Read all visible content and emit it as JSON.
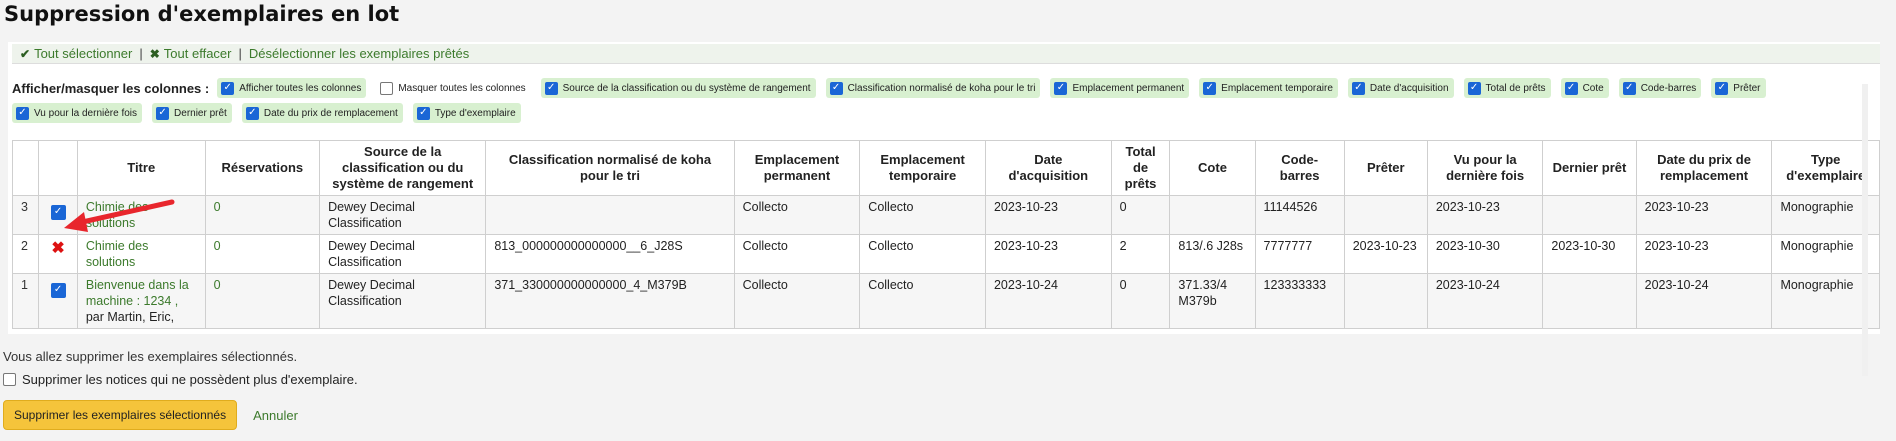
{
  "title": "Suppression d'exemplaires en lot",
  "toolbar": {
    "select_all": "Tout sélectionner",
    "clear_all": "Tout effacer",
    "deselect_loaned": "Désélectionner les exemplaires prêtés",
    "separator": "|"
  },
  "columns_toggle": {
    "label": "Afficher/masquer les colonnes :",
    "options": [
      {
        "label": "Afficher toutes les colonnes",
        "checked": true
      },
      {
        "label": "Masquer toutes les colonnes",
        "checked": false
      },
      {
        "label": "Source de la classification ou du système de rangement",
        "checked": true
      },
      {
        "label": "Classification normalisé de koha pour le tri",
        "checked": true
      },
      {
        "label": "Emplacement permanent",
        "checked": true
      },
      {
        "label": "Emplacement temporaire",
        "checked": true
      },
      {
        "label": "Date d'acquisition",
        "checked": true
      },
      {
        "label": "Total de prêts",
        "checked": true
      },
      {
        "label": "Cote",
        "checked": true
      },
      {
        "label": "Code-barres",
        "checked": true
      },
      {
        "label": "Prêter",
        "checked": true
      },
      {
        "label": "Vu pour la dernière fois",
        "checked": true
      },
      {
        "label": "Dernier prêt",
        "checked": true
      },
      {
        "label": "Date du prix de remplacement",
        "checked": true
      },
      {
        "label": "Type d'exemplaire",
        "checked": true
      }
    ]
  },
  "table": {
    "headers": [
      "Titre",
      "Réservations",
      "Source de la classification ou du système de rangement",
      "Classification normalisé de koha pour le tri",
      "Emplacement permanent",
      "Emplacement temporaire",
      "Date d'acquisition",
      "Total de prêts",
      "Cote",
      "Code-barres",
      "Prêter",
      "Vu pour la dernière fois",
      "Dernier prêt",
      "Date du prix de remplacement",
      "Type d'exemplaire"
    ],
    "rows": [
      {
        "num": "3",
        "state": "checked",
        "title": "Chimie des solutions",
        "author": "",
        "reservations": "0",
        "source": "Dewey Decimal Classification",
        "sort": "",
        "perm": "Collecto",
        "temp": "Collecto",
        "acq": "2023-10-23",
        "issues": "0",
        "cote": "",
        "barcode": "11144526",
        "loaned": "",
        "seen": "2023-10-23",
        "last_loan": "",
        "repl_date": "2023-10-23",
        "type": "Monographie"
      },
      {
        "num": "2",
        "state": "blocked",
        "title": "Chimie des solutions",
        "author": "",
        "reservations": "0",
        "source": "Dewey Decimal Classification",
        "sort": "813_000000000000000__6_J28S",
        "perm": "Collecto",
        "temp": "Collecto",
        "acq": "2023-10-23",
        "issues": "2",
        "cote": "813/.6 J28s",
        "barcode": "7777777",
        "loaned": "2023-10-23",
        "seen": "2023-10-30",
        "last_loan": "2023-10-30",
        "repl_date": "2023-10-23",
        "type": "Monographie"
      },
      {
        "num": "1",
        "state": "checked",
        "title": "Bienvenue dans la machine : 1234 ,",
        "author": "par Martin, Eric,",
        "reservations": "0",
        "source": "Dewey Decimal Classification",
        "sort": "371_330000000000000_4_M379B",
        "perm": "Collecto",
        "temp": "Collecto",
        "acq": "2023-10-24",
        "issues": "0",
        "cote": "371.33/4 M379b",
        "barcode": "123333333",
        "loaned": "",
        "seen": "2023-10-24",
        "last_loan": "",
        "repl_date": "2023-10-24",
        "type": "Monographie"
      }
    ]
  },
  "warning": "Vous allez supprimer les exemplaires sélectionnés.",
  "delete_records_label": "Supprimer les notices qui ne possèdent plus d'exemplaire.",
  "delete_button": "Supprimer les exemplaires sélectionnés",
  "cancel": "Annuler",
  "colors": {
    "accent_link": "#3c7a2c",
    "chip_bg": "#d8f0d0",
    "checkbox": "#1a66d6",
    "button": "#f5c43b",
    "annotation_arrow": "#e8262d"
  }
}
